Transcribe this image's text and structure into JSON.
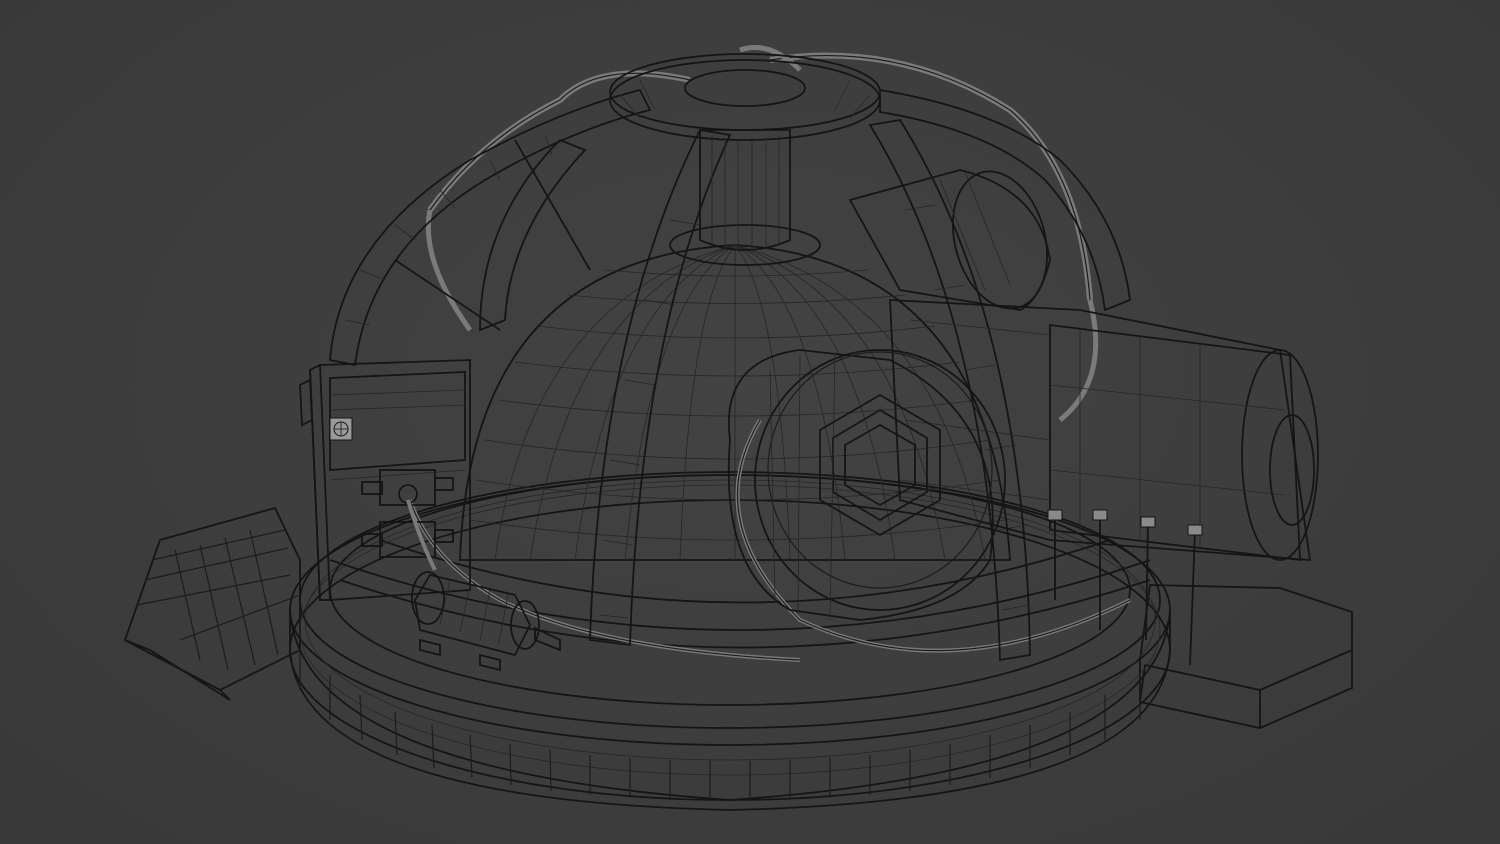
{
  "viewport": {
    "mode": "wireframe-solid",
    "background_color": "#3d3d3d",
    "mesh_color": "#a9a9a9",
    "mesh_shadow_color": "#7a7a7a",
    "mesh_highlight_color": "#c2c2c2",
    "wire_color": "#1c1c1c"
  },
  "scene": {
    "objects": [
      "base-platform",
      "dome",
      "top-collar",
      "cage-ribs",
      "cables",
      "control-panel",
      "hex-bolt-disc",
      "main-cylinder",
      "rear-cylinder",
      "side-step",
      "front-ramp",
      "power-canister"
    ]
  }
}
